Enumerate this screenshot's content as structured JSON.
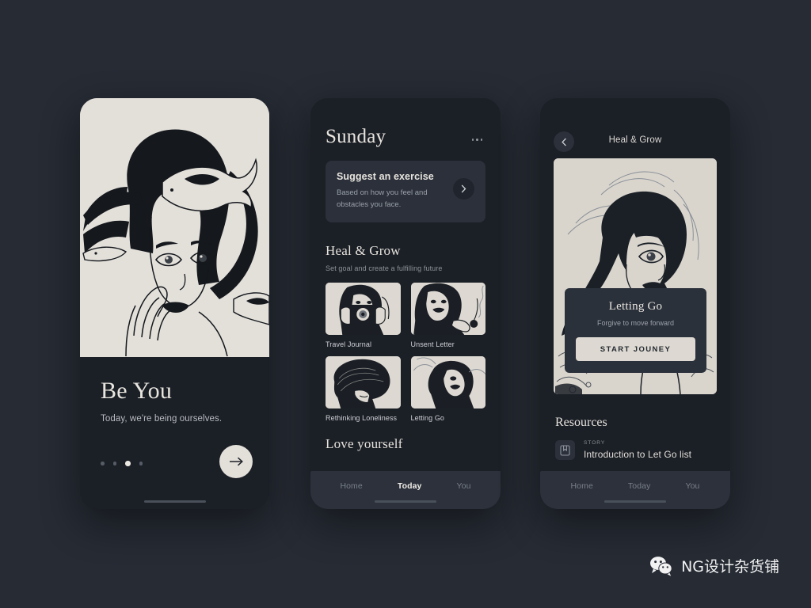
{
  "canvas": {
    "background_color": "#262b34",
    "cream_color": "#e3e0da",
    "card_color": "#2b303a",
    "panel_color": "#1b1f26"
  },
  "screen_onboarding": {
    "name": "Be You onboarding",
    "title": "Be You",
    "subtitle": "Today, we're being ourselves.",
    "pager": {
      "total": 4,
      "active_index": 3
    },
    "next_icon": "arrow-right-icon"
  },
  "screen_today": {
    "day_title": "Sunday",
    "menu_icon": "kebab-menu-icon",
    "suggest_card": {
      "title": "Suggest an exercise",
      "subtitle": "Based on how you feel and obstacles you face.",
      "action_icon": "chevron-right-icon"
    },
    "heal_section": {
      "title": "Heal & Grow",
      "subtitle": "Set goal and create a fulfilling future",
      "cards": [
        {
          "label": "Travel Journal",
          "art": "woman-with-camera"
        },
        {
          "label": "Unsent Letter",
          "art": "woman-holding-rose"
        },
        {
          "label": "Rethinking Loneliness",
          "art": "woman-head-down"
        },
        {
          "label": "Letting Go",
          "art": "woman-looking-back"
        }
      ]
    },
    "next_section_title": "Love yourself",
    "tabs": [
      {
        "label": "Home",
        "active": false
      },
      {
        "label": "Today",
        "active": true
      },
      {
        "label": "You",
        "active": false
      }
    ]
  },
  "screen_detail": {
    "back_icon": "chevron-left-icon",
    "header_title": "Heal & Grow",
    "hero_art": "woman-looking-back-large",
    "overlay": {
      "title": "Letting Go",
      "subtitle": "Forgive to move forward",
      "button_label": "START JOUNEY"
    },
    "resources": {
      "title": "Resources",
      "items": [
        {
          "kicker": "STORY",
          "name": "Introduction to Let Go list",
          "icon": "book-bookmark-icon"
        }
      ]
    },
    "tabs": [
      {
        "label": "Home",
        "active": false
      },
      {
        "label": "Today",
        "active": false
      },
      {
        "label": "You",
        "active": false
      }
    ]
  },
  "watermark": {
    "icon": "wechat-icon",
    "text": "NG设计杂货铺"
  }
}
